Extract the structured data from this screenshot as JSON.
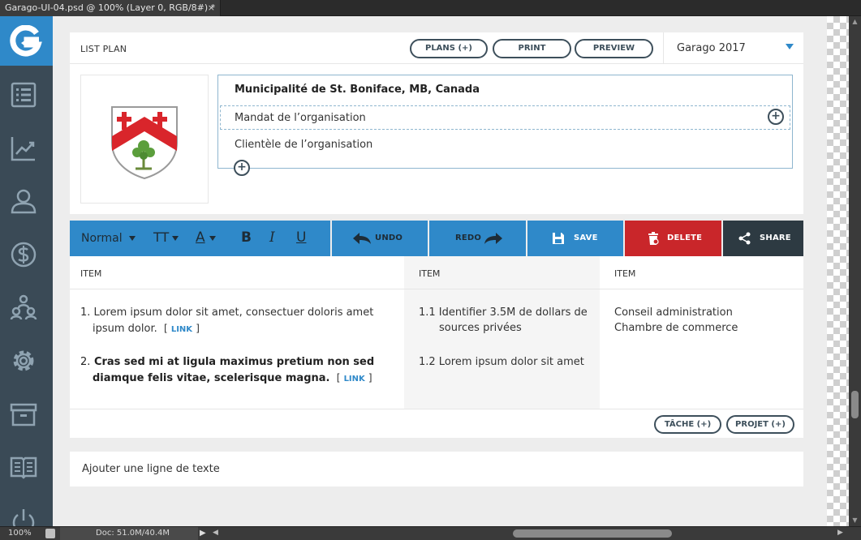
{
  "ps": {
    "tab_title": "Garago-UI-04.psd @ 100% (Layer 0, RGB/8#) *",
    "close_glyph": "×",
    "zoom": "100%",
    "doc_info": "Doc: 51.0M/40.4M"
  },
  "sidebar": {
    "logo_letter": "G",
    "items": [
      {
        "icon": "list-icon"
      },
      {
        "icon": "chart-line-icon"
      },
      {
        "icon": "user-icon"
      },
      {
        "icon": "dollar-icon"
      },
      {
        "icon": "team-icon"
      },
      {
        "icon": "gear-icon"
      },
      {
        "icon": "archive-icon"
      },
      {
        "icon": "book-icon"
      },
      {
        "icon": "power-icon"
      }
    ]
  },
  "header": {
    "title": "LIST PLAN",
    "buttons": {
      "plans": "PLANS (+)",
      "print": "PRINT",
      "preview": "PREVIEW"
    },
    "year_select": "Garago 2017"
  },
  "org": {
    "name": "Municipalité de St. Boniface, MB, Canada",
    "mandat": "Mandat de l’organisation",
    "clientele": "Clientèle de l’organisation",
    "plus": "+"
  },
  "toolbar": {
    "style_select": "Normal",
    "text_size_glyph": "TT",
    "font_color_glyph": "A",
    "bold": "B",
    "italic": "I",
    "underline": "U",
    "undo": "UNDO",
    "redo": "REDO",
    "save": "SAVE",
    "delete": "DELETE",
    "share": "SHARE"
  },
  "table": {
    "headers": [
      "ITEM",
      "ITEM",
      "ITEM"
    ],
    "col1": {
      "row1_num": "1.",
      "row1_text_a": "Lorem ipsum dolor sit amet, consectuer doloris amet",
      "row1_text_b": "ipsum dolor.",
      "row2_num": "2.",
      "row2_text_a": "Cras sed mi at ligula maximus pretium non sed",
      "row2_text_b": "diamque felis vitae, scelerisque magna.",
      "link": "LINK",
      "bracket_open": "[",
      "bracket_close": "]"
    },
    "col2": {
      "row1_a": "1.1 Identifier 3.5M de dollars de",
      "row1_b": "sources privées",
      "row2": "1.2 Lorem ipsum dolor sit amet"
    },
    "col3": {
      "line1": "Conseil administration",
      "line2": "Chambre de commerce"
    },
    "buttons": {
      "tache": "TÂCHE (+)",
      "projet": "PROJET (+)"
    }
  },
  "add_line": "Ajouter une ligne de texte",
  "colors": {
    "accent_blue": "#2f89c9",
    "sidebar_bg": "#3a4a56",
    "danger_red": "#c9262a",
    "dark": "#2d3a42"
  }
}
